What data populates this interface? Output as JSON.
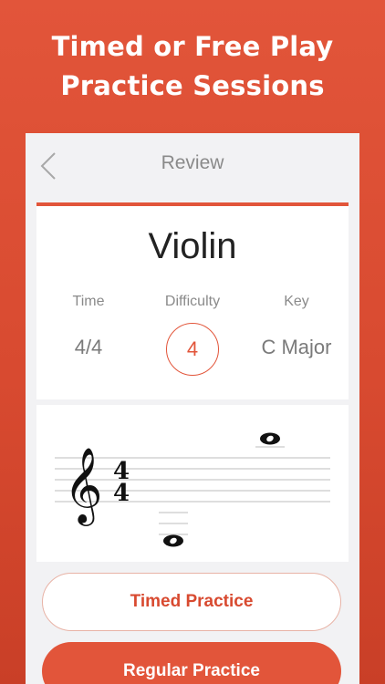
{
  "promo": {
    "headline_line1": "Timed or Free Play",
    "headline_line2": "Practice Sessions"
  },
  "nav": {
    "title": "Review"
  },
  "review": {
    "instrument": "Violin",
    "time_label": "Time",
    "time_value": "4/4",
    "difficulty_label": "Difficulty",
    "difficulty_value": "4",
    "key_label": "Key",
    "key_value": "C Major"
  },
  "staff": {
    "clef": "treble",
    "time_signature_top": "4",
    "time_signature_bottom": "4",
    "notes": [
      "whole note above staff",
      "whole note below staff"
    ]
  },
  "actions": {
    "timed_label": "Timed Practice",
    "regular_label": "Regular Practice"
  },
  "colors": {
    "accent": "#e2553a",
    "background_gradient_top": "#e2553a",
    "background_gradient_bottom": "#c93f27",
    "panel": "#f2f2f4"
  }
}
